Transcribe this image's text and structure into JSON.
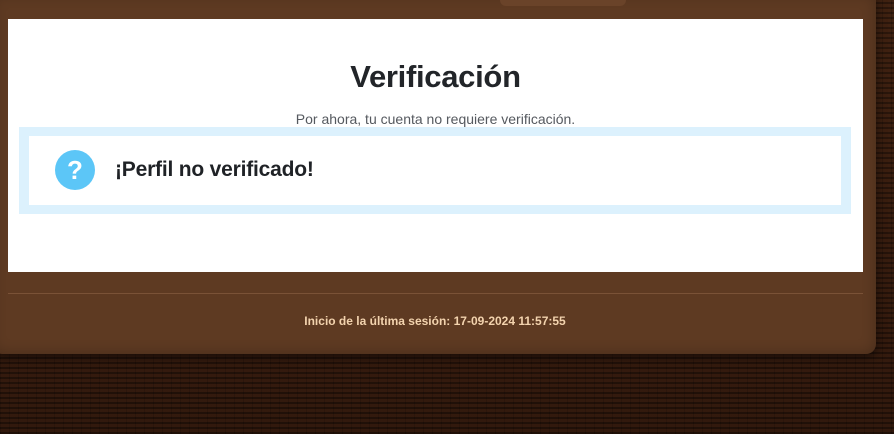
{
  "verification": {
    "title": "Verificación",
    "subtitle": "Por ahora, tu cuenta no requiere verificación.",
    "alert": {
      "icon": "question-circle-icon",
      "icon_glyph": "?",
      "message": "¡Perfil no verificado!"
    }
  },
  "footer": {
    "last_login": "Inicio de la última sesión: 17-09-2024 11:57:55"
  },
  "colors": {
    "frame": "#5e3a22",
    "card": "#ffffff",
    "alert_border": "#dcf1fd",
    "alert_icon": "#5cc6f7",
    "footer_text": "#f3d3ae",
    "background": "#2b160c"
  }
}
